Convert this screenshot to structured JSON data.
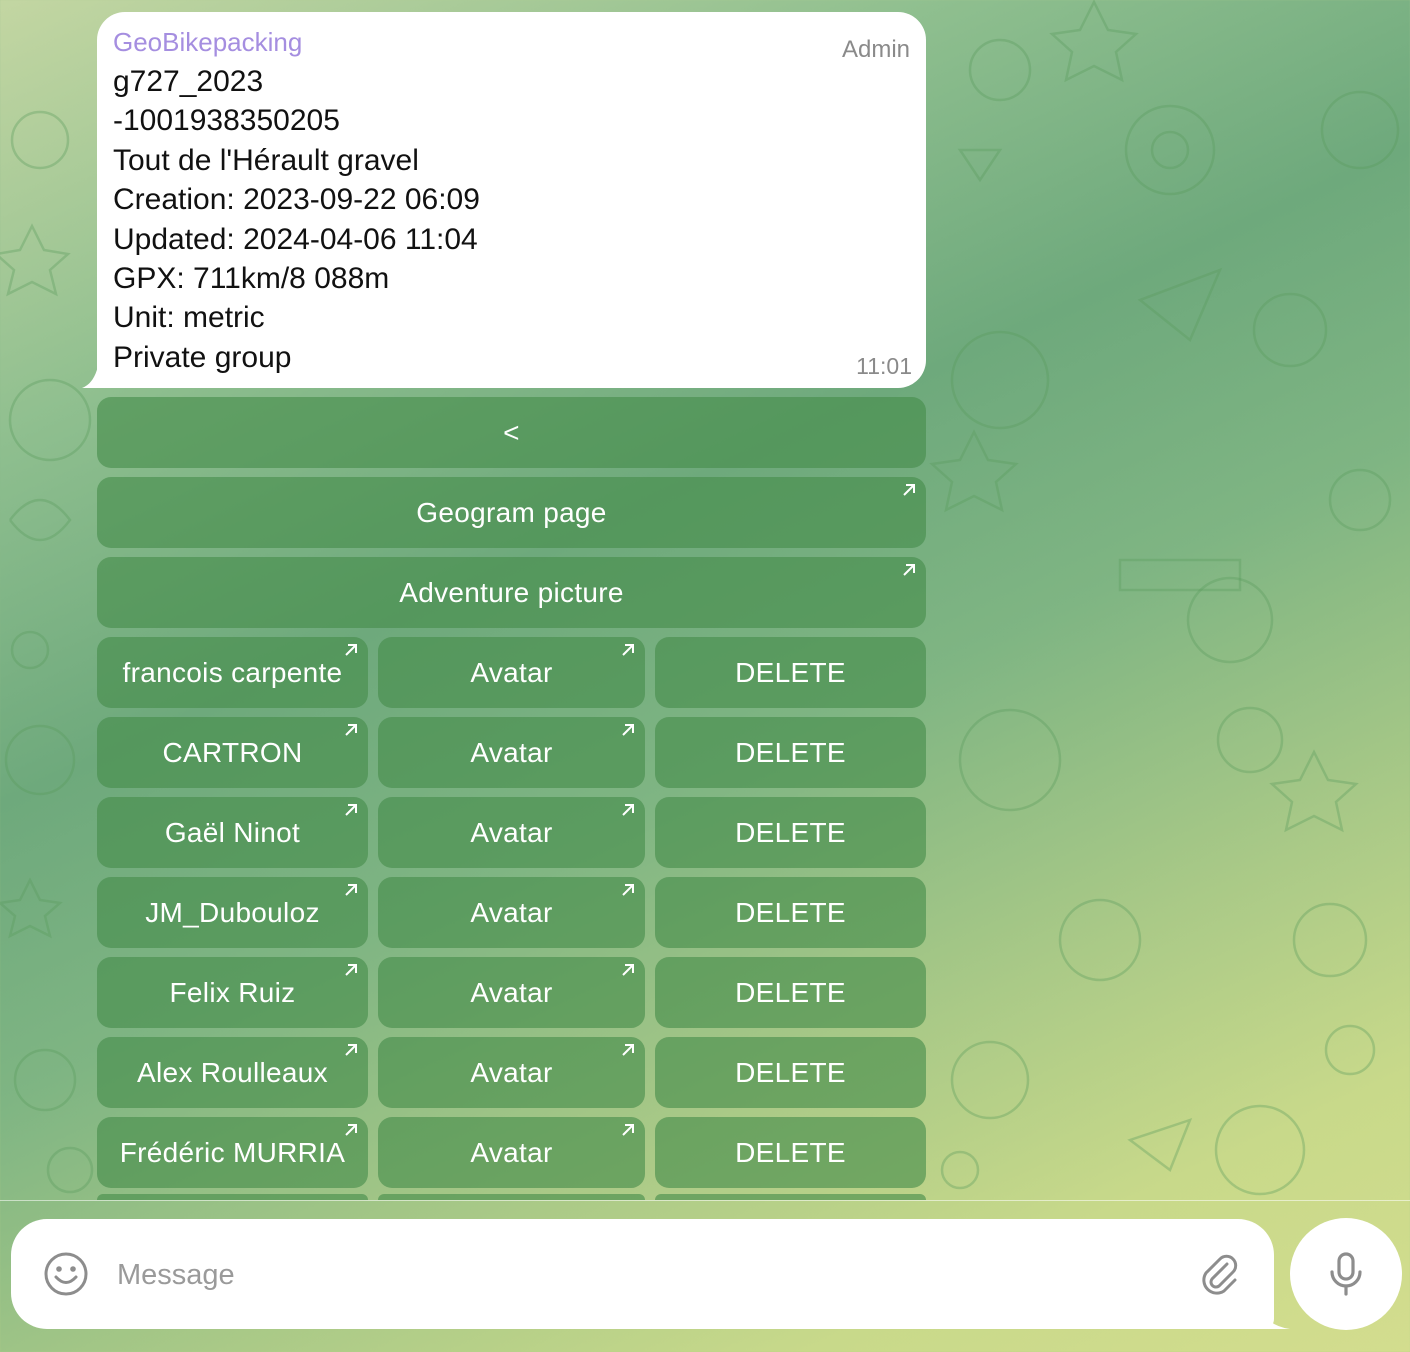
{
  "chat": {
    "message": {
      "sender": "GeoBikepacking",
      "role_badge": "Admin",
      "lines": [
        "g727_2023",
        "-1001938350205",
        "Tout de l'Hérault gravel",
        "Creation: 2023-09-22 06:09",
        "Updated: 2024-04-06 11:04",
        "GPX: 711km/8 088m",
        "Unit: metric",
        "Private group"
      ],
      "time": "11:01"
    },
    "keyboard": {
      "back_label": "<",
      "geogram_page_label": "Geogram page",
      "adventure_picture_label": "Adventure picture",
      "members": [
        {
          "name": "francois carpente",
          "avatar_label": "Avatar",
          "delete_label": "DELETE"
        },
        {
          "name": "CARTRON",
          "avatar_label": "Avatar",
          "delete_label": "DELETE"
        },
        {
          "name": "Gaël Ninot",
          "avatar_label": "Avatar",
          "delete_label": "DELETE"
        },
        {
          "name": "JM_Dubouloz",
          "avatar_label": "Avatar",
          "delete_label": "DELETE"
        },
        {
          "name": "Felix Ruiz",
          "avatar_label": "Avatar",
          "delete_label": "DELETE"
        },
        {
          "name": "Alex Roulleaux",
          "avatar_label": "Avatar",
          "delete_label": "DELETE"
        },
        {
          "name": "Frédéric MURRIA",
          "avatar_label": "Avatar",
          "delete_label": "DELETE"
        }
      ]
    }
  },
  "composer": {
    "placeholder": "Message",
    "emoji_icon": "smiley-icon",
    "attach_icon": "paperclip-icon",
    "mic_icon": "microphone-icon"
  },
  "colors": {
    "sender_name": "#a58ee0",
    "keyboard_button": "#468c4b",
    "bubble": "#ffffff"
  }
}
